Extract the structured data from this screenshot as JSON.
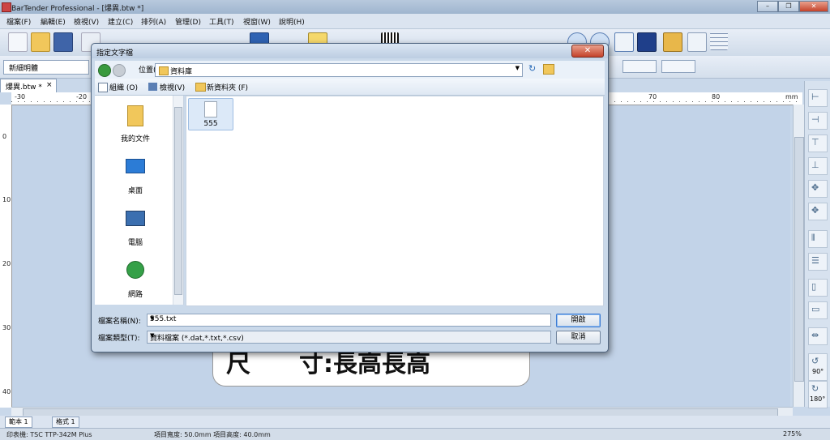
{
  "window": {
    "title": "BarTender Professional - [爆異.btw *]"
  },
  "menu": [
    "檔案(F)",
    "編輯(E)",
    "檢視(V)",
    "建立(C)",
    "排列(A)",
    "管理(D)",
    "工具(T)",
    "視窗(W)",
    "說明(H)"
  ],
  "format": {
    "font_name": "新細明體"
  },
  "doc_tab": {
    "label": "爆異.btw *",
    "close": "×"
  },
  "ruler": {
    "h_labels": [
      "-30",
      "-20",
      "70",
      "80"
    ],
    "unit": "mm",
    "v_labels": [
      "0",
      "10",
      "20",
      "30",
      "40"
    ]
  },
  "label_text": "尺　　寸:長高長高",
  "right_panel": {
    "rotate_90": "90°",
    "rotate_180": "180°"
  },
  "sheet_tabs": [
    "範本 1",
    "格式 1"
  ],
  "status": {
    "printer": "印表機: TSC TTP-342M Plus",
    "size": "項目寬度: 50.0mm  項目高度: 40.0mm",
    "zoom": "275%"
  },
  "dialog": {
    "title": "指定文字檔",
    "location_label": "位置(L):",
    "location_value": "資料庫",
    "organize": "組織 (O)",
    "views": "檢視(V)",
    "new_folder": "新資料夾 (F)",
    "places": [
      "我的文件",
      "桌面",
      "電腦",
      "網路"
    ],
    "files": [
      {
        "name": "555"
      }
    ],
    "filename_label": "檔案名稱(N):",
    "filename_value": "555.txt",
    "filetype_label": "檔案類型(T):",
    "filetype_value": "資料檔案 (*.dat,*.txt,*.csv)",
    "open_button": "開啟",
    "cancel_button": "取消"
  }
}
